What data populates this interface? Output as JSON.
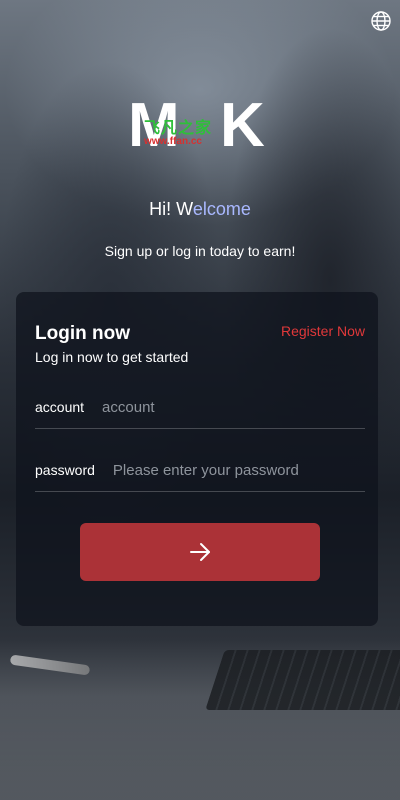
{
  "brand": {
    "logo_left": "M",
    "logo_right": "K",
    "watermark_cn": "飞凡之家",
    "watermark_url": "www.ffan.cc"
  },
  "header": {
    "greeting_hi": "Hi! W",
    "greeting_rest": "elcome",
    "subtitle": "Sign up or log in today to earn!"
  },
  "icons": {
    "language": "globe-icon",
    "submit": "arrow-right-icon"
  },
  "login": {
    "title": "Login now",
    "subtitle": "Log in now to get started",
    "register_link": "Register Now",
    "account": {
      "label": "account",
      "placeholder": "account",
      "value": ""
    },
    "password": {
      "label": "password",
      "placeholder": "Please enter your password",
      "value": ""
    }
  },
  "colors": {
    "accent": "#ab3237",
    "link": "#e0383a",
    "welcome_highlight": "#a9b8ff"
  }
}
